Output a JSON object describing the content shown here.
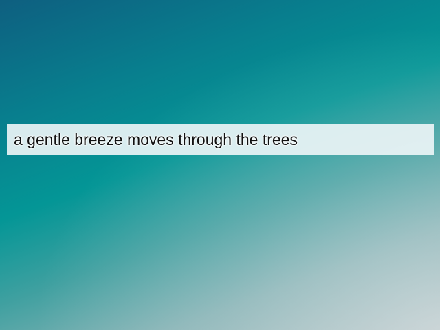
{
  "text_input": {
    "value": "a gentle breeze moves through the trees"
  }
}
